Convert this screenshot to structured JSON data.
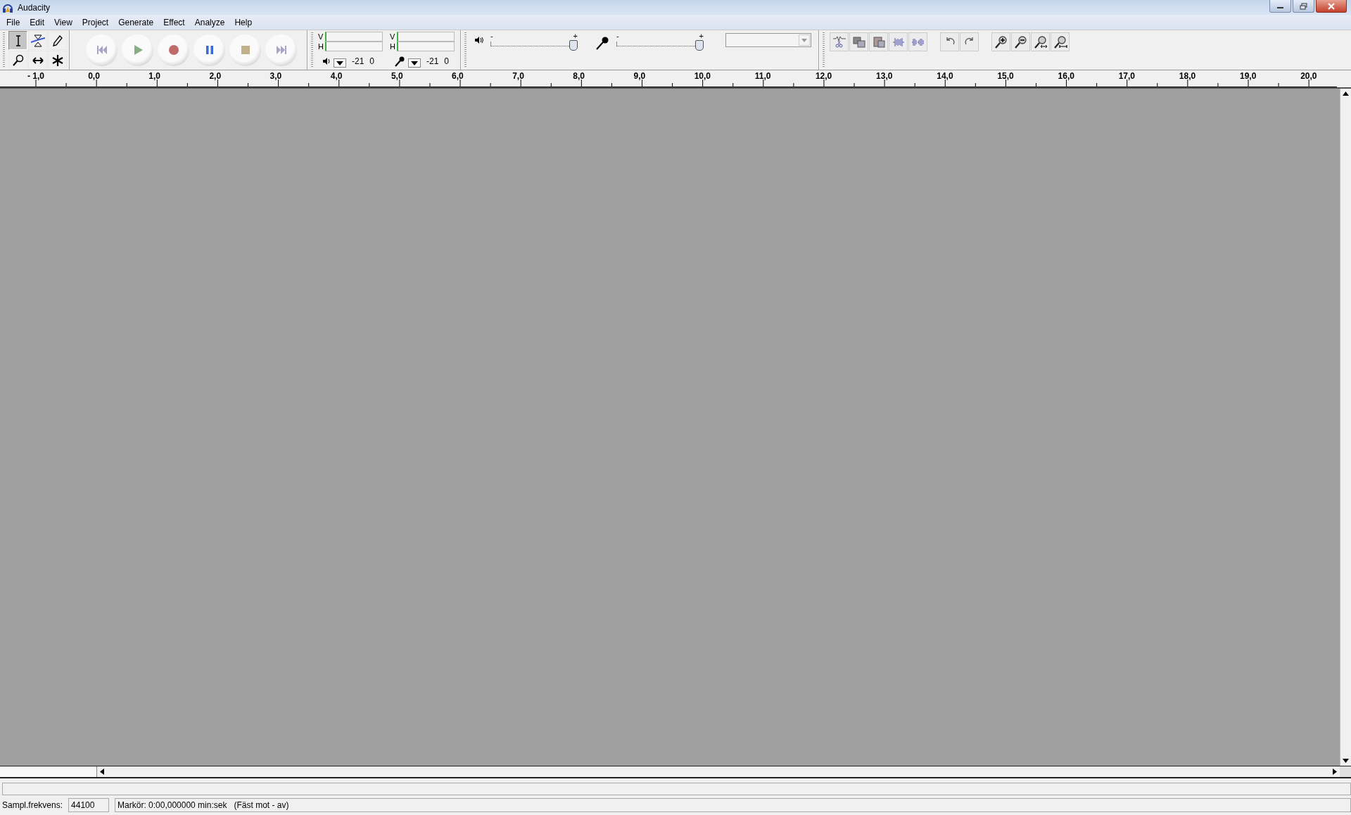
{
  "window": {
    "title": "Audacity"
  },
  "menu": [
    "File",
    "Edit",
    "View",
    "Project",
    "Generate",
    "Effect",
    "Analyze",
    "Help"
  ],
  "tools": [
    {
      "kind": "select",
      "selected": true
    },
    {
      "kind": "envelope",
      "selected": false
    },
    {
      "kind": "draw",
      "selected": false
    },
    {
      "kind": "zoom",
      "selected": false
    },
    {
      "kind": "timeshift",
      "selected": false
    },
    {
      "kind": "multi",
      "selected": false
    }
  ],
  "meters": [
    {
      "kind": "playback",
      "channels": [
        "V",
        "H"
      ],
      "scale": [
        "-21",
        "0"
      ]
    },
    {
      "kind": "recording",
      "channels": [
        "V",
        "H"
      ],
      "scale": [
        "-21",
        "0"
      ]
    }
  ],
  "mixer": [
    {
      "kind": "playback",
      "min_label": "-",
      "max_label": "+",
      "level": 1
    },
    {
      "kind": "recording",
      "min_label": "-",
      "max_label": "+",
      "level": 1
    }
  ],
  "ruler": [
    "- 1,0",
    "0,0",
    "1,0",
    "2,0",
    "3,0",
    "4,0",
    "5,0",
    "6,0",
    "7,0",
    "8,0",
    "9,0",
    "10,0",
    "11,0",
    "12,0",
    "13,0",
    "14,0",
    "15,0",
    "16,0",
    "17,0",
    "18,0",
    "19,0",
    "20,0"
  ],
  "status_bar": {
    "rate_label": "Sampl.frekvens:",
    "rate": "44100",
    "cursor": "Markör: 0:00,000000 min:sek   (Fäst mot - av)"
  }
}
